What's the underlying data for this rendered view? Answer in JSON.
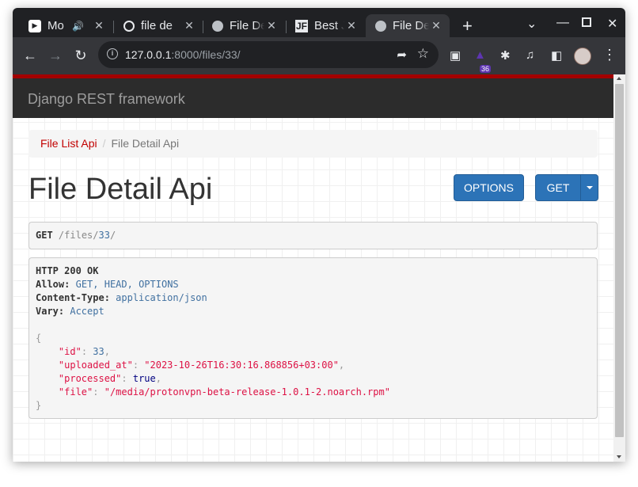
{
  "browser": {
    "tabs": [
      {
        "title": "Mo",
        "icon": "youtube-music-icon",
        "audio": true
      },
      {
        "title": "file de",
        "icon": "github-icon"
      },
      {
        "title": "File De",
        "icon": "globe-icon"
      },
      {
        "title": "Best JS",
        "icon": "jf-icon"
      },
      {
        "title": "File De",
        "icon": "globe-icon",
        "active": true
      }
    ],
    "new_tab_label": "+",
    "url_host": "127.0.0.1",
    "url_rest": ":8000/files/33/",
    "extension_badge": "36"
  },
  "navbar": {
    "brand": "Django REST framework",
    "accent_color": "#a30000"
  },
  "breadcrumb": {
    "parent": "File List Api",
    "separator": "/",
    "current": "File Detail Api"
  },
  "page": {
    "title": "File Detail Api",
    "options_button": "OPTIONS",
    "get_button": "GET"
  },
  "request": {
    "method": "GET",
    "path_prefix": "/files/",
    "path_id": "33",
    "path_suffix": "/"
  },
  "response": {
    "status": "HTTP 200 OK",
    "headers": [
      {
        "key": "Allow:",
        "value": "GET, HEAD, OPTIONS"
      },
      {
        "key": "Content-Type:",
        "value": "application/json"
      },
      {
        "key": "Vary:",
        "value": "Accept"
      }
    ],
    "body": {
      "id_key": "\"id\"",
      "id_value": "33",
      "uploaded_at_key": "\"uploaded_at\"",
      "uploaded_at_value": "\"2023-10-26T16:30:16.868856+03:00\"",
      "processed_key": "\"processed\"",
      "processed_value": "true",
      "file_key": "\"file\"",
      "file_value": "\"/media/protonvpn-beta-release-1.0.1-2.noarch.rpm\""
    }
  }
}
